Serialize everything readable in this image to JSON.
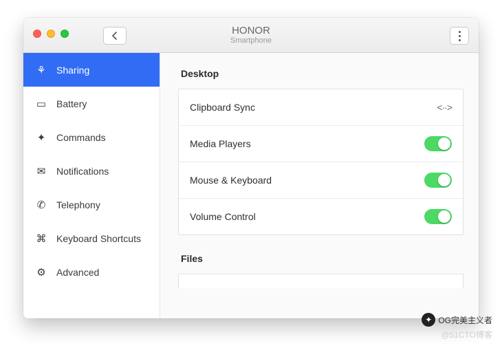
{
  "titlebar": {
    "title": "HONOR",
    "subtitle": "Smartphone"
  },
  "sidebar": {
    "items": [
      {
        "label": "Sharing",
        "icon": "share-icon",
        "glyph": "⚘"
      },
      {
        "label": "Battery",
        "icon": "battery-icon",
        "glyph": "▭"
      },
      {
        "label": "Commands",
        "icon": "commands-icon",
        "glyph": "✦"
      },
      {
        "label": "Notifications",
        "icon": "notifications-icon",
        "glyph": "✉"
      },
      {
        "label": "Telephony",
        "icon": "telephony-icon",
        "glyph": "✆"
      },
      {
        "label": "Keyboard Shortcuts",
        "icon": "keyboard-icon",
        "glyph": "⌘"
      },
      {
        "label": "Advanced",
        "icon": "advanced-icon",
        "glyph": "⚙"
      }
    ],
    "active_index": 0
  },
  "sections": {
    "desktop": {
      "title": "Desktop",
      "rows": [
        {
          "label": "Clipboard Sync",
          "control": "link",
          "name": "clipboard-sync-row"
        },
        {
          "label": "Media Players",
          "control": "toggle",
          "on": true,
          "name": "media-players-row"
        },
        {
          "label": "Mouse & Keyboard",
          "control": "toggle",
          "on": true,
          "name": "mouse-keyboard-row"
        },
        {
          "label": "Volume Control",
          "control": "toggle",
          "on": true,
          "name": "volume-control-row"
        }
      ]
    },
    "files": {
      "title": "Files"
    }
  },
  "watermark": {
    "wechat": "OG完美主义者",
    "blog": "@51CTO博客"
  }
}
